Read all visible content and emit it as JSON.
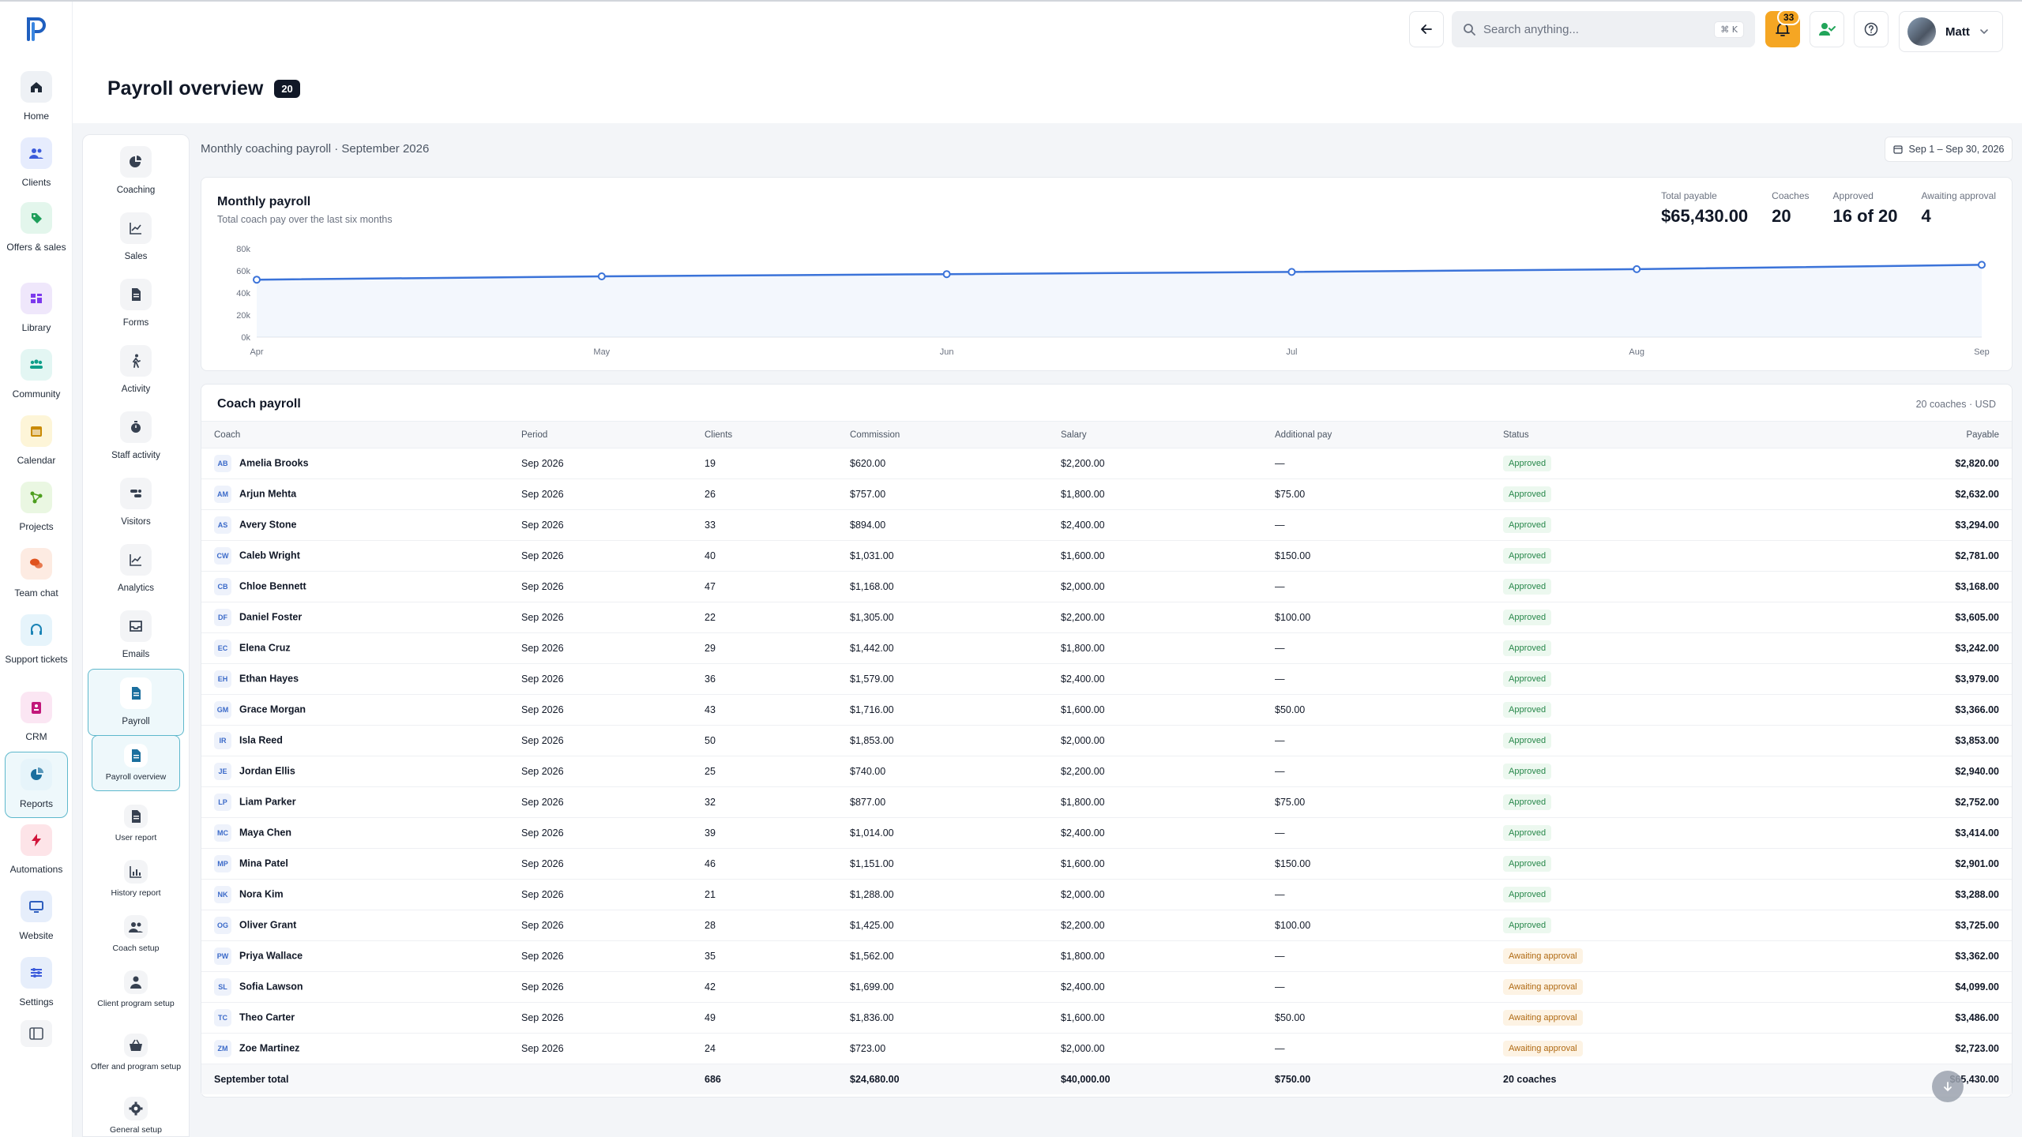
{
  "app": {
    "brand": "P"
  },
  "rail": {
    "items": [
      {
        "label": "Home",
        "icon": "home-icon",
        "color": "#eef1f5",
        "fg": "#1f2937"
      },
      {
        "label": "Clients",
        "icon": "users-icon",
        "color": "#e6ecfd",
        "fg": "#3b5bdb"
      },
      {
        "label": "Offers & sales",
        "icon": "tag-icon",
        "color": "#e3f6ec",
        "fg": "#1e9e5a"
      },
      {
        "label": "Library",
        "icon": "library-icon",
        "color": "#efe7fb",
        "fg": "#7c3aed"
      },
      {
        "label": "Community",
        "icon": "community-icon",
        "color": "#e3f6f3",
        "fg": "#0f9f8a"
      },
      {
        "label": "Calendar",
        "icon": "calendar-icon",
        "color": "#fdf5d8",
        "fg": "#c98a04"
      },
      {
        "label": "Projects",
        "icon": "projects-icon",
        "color": "#eaf7e2",
        "fg": "#4d9e1e"
      },
      {
        "label": "Team chat",
        "icon": "chat-icon",
        "color": "#fdebe2",
        "fg": "#e0531e"
      },
      {
        "label": "Support tickets",
        "icon": "headset-icon",
        "color": "#e6f4fb",
        "fg": "#1b84b6"
      },
      {
        "label": "CRM",
        "icon": "crm-icon",
        "color": "#fbe6f3",
        "fg": "#c2187a"
      },
      {
        "label": "Reports",
        "icon": "reports-icon",
        "color": "#e6f4fa",
        "fg": "#1b6f9e",
        "active": true
      },
      {
        "label": "Automations",
        "icon": "bolt-icon",
        "color": "#fde4e8",
        "fg": "#d1143a"
      },
      {
        "label": "Website",
        "icon": "monitor-icon",
        "color": "#e6eefb",
        "fg": "#2f5fbf"
      },
      {
        "label": "Settings",
        "icon": "sliders-icon",
        "color": "#e6eefb",
        "fg": "#3b5bdb"
      }
    ]
  },
  "header": {
    "title": "Payroll overview",
    "count": "20",
    "search_placeholder": "Search anything...",
    "search_shortcut": "⌘ K",
    "notifications": "33",
    "user_name": "Matt"
  },
  "subnav": {
    "items": [
      {
        "label": "Coaching",
        "icon": "pie-icon"
      },
      {
        "label": "Sales",
        "icon": "line-chart-icon"
      },
      {
        "label": "Forms",
        "icon": "document-icon"
      },
      {
        "label": "Activity",
        "icon": "walk-icon"
      },
      {
        "label": "Staff activity",
        "icon": "stopwatch-icon"
      },
      {
        "label": "Visitors",
        "icon": "visitors-icon"
      },
      {
        "label": "Analytics",
        "icon": "line-chart-icon"
      },
      {
        "label": "Emails",
        "icon": "inbox-icon"
      },
      {
        "label": "Payroll",
        "icon": "document-icon",
        "active": true
      },
      {
        "label": "Payroll overview",
        "icon": "document-icon",
        "active": true
      },
      {
        "label": "User report",
        "icon": "document-icon"
      },
      {
        "label": "History report",
        "icon": "bar-chart-icon"
      },
      {
        "label": "Coach setup",
        "icon": "users-icon"
      },
      {
        "label": "Client program setup",
        "icon": "user-icon"
      },
      {
        "label": "Offer and program setup",
        "icon": "basket-icon"
      },
      {
        "label": "General setup",
        "icon": "gear-icon"
      }
    ]
  },
  "main": {
    "breadcrumb": "Monthly coaching payroll · September 2026",
    "date_range": "Sep 1 – Sep 30, 2026"
  },
  "summary": {
    "title": "Monthly payroll",
    "subtitle": "Total coach pay over the last six months",
    "kpis": [
      {
        "label": "Total payable",
        "value": "$65,430.00"
      },
      {
        "label": "Coaches",
        "value": "20"
      },
      {
        "label": "Approved",
        "value": "16 of 20"
      },
      {
        "label": "Awaiting approval",
        "value": "4"
      }
    ]
  },
  "chart_data": {
    "type": "area",
    "title": "Monthly payroll",
    "categories": [
      "Apr",
      "May",
      "Jun",
      "Jul",
      "Aug",
      "Sep"
    ],
    "series": [
      {
        "values": [
          52000,
          55000,
          57000,
          59000,
          61500,
          65430
        ]
      }
    ],
    "y_ticks": [
      "0k",
      "20k",
      "40k",
      "60k",
      "80k"
    ],
    "ylim": [
      0,
      80000
    ],
    "grid": false,
    "color": "#3b73d9"
  },
  "table": {
    "title": "Coach payroll",
    "meta": "20 coaches · USD",
    "columns": [
      "Coach",
      "Period",
      "Clients",
      "Commission",
      "Salary",
      "Additional pay",
      "Status",
      "Payable"
    ],
    "rows": [
      {
        "initials": "AB",
        "name": "Amelia Brooks",
        "period": "Sep 2026",
        "clients": "19",
        "commission": "$620.00",
        "salary": "$2,200.00",
        "additional": "—",
        "status": "Approved",
        "payable": "$2,820.00"
      },
      {
        "initials": "AM",
        "name": "Arjun Mehta",
        "period": "Sep 2026",
        "clients": "26",
        "commission": "$757.00",
        "salary": "$1,800.00",
        "additional": "$75.00",
        "status": "Approved",
        "payable": "$2,632.00"
      },
      {
        "initials": "AS",
        "name": "Avery Stone",
        "period": "Sep 2026",
        "clients": "33",
        "commission": "$894.00",
        "salary": "$2,400.00",
        "additional": "—",
        "status": "Approved",
        "payable": "$3,294.00"
      },
      {
        "initials": "CW",
        "name": "Caleb Wright",
        "period": "Sep 2026",
        "clients": "40",
        "commission": "$1,031.00",
        "salary": "$1,600.00",
        "additional": "$150.00",
        "status": "Approved",
        "payable": "$2,781.00"
      },
      {
        "initials": "CB",
        "name": "Chloe Bennett",
        "period": "Sep 2026",
        "clients": "47",
        "commission": "$1,168.00",
        "salary": "$2,000.00",
        "additional": "—",
        "status": "Approved",
        "payable": "$3,168.00"
      },
      {
        "initials": "DF",
        "name": "Daniel Foster",
        "period": "Sep 2026",
        "clients": "22",
        "commission": "$1,305.00",
        "salary": "$2,200.00",
        "additional": "$100.00",
        "status": "Approved",
        "payable": "$3,605.00"
      },
      {
        "initials": "EC",
        "name": "Elena Cruz",
        "period": "Sep 2026",
        "clients": "29",
        "commission": "$1,442.00",
        "salary": "$1,800.00",
        "additional": "—",
        "status": "Approved",
        "payable": "$3,242.00"
      },
      {
        "initials": "EH",
        "name": "Ethan Hayes",
        "period": "Sep 2026",
        "clients": "36",
        "commission": "$1,579.00",
        "salary": "$2,400.00",
        "additional": "—",
        "status": "Approved",
        "payable": "$3,979.00"
      },
      {
        "initials": "GM",
        "name": "Grace Morgan",
        "period": "Sep 2026",
        "clients": "43",
        "commission": "$1,716.00",
        "salary": "$1,600.00",
        "additional": "$50.00",
        "status": "Approved",
        "payable": "$3,366.00"
      },
      {
        "initials": "IR",
        "name": "Isla Reed",
        "period": "Sep 2026",
        "clients": "50",
        "commission": "$1,853.00",
        "salary": "$2,000.00",
        "additional": "—",
        "status": "Approved",
        "payable": "$3,853.00"
      },
      {
        "initials": "JE",
        "name": "Jordan Ellis",
        "period": "Sep 2026",
        "clients": "25",
        "commission": "$740.00",
        "salary": "$2,200.00",
        "additional": "—",
        "status": "Approved",
        "payable": "$2,940.00"
      },
      {
        "initials": "LP",
        "name": "Liam Parker",
        "period": "Sep 2026",
        "clients": "32",
        "commission": "$877.00",
        "salary": "$1,800.00",
        "additional": "$75.00",
        "status": "Approved",
        "payable": "$2,752.00"
      },
      {
        "initials": "MC",
        "name": "Maya Chen",
        "period": "Sep 2026",
        "clients": "39",
        "commission": "$1,014.00",
        "salary": "$2,400.00",
        "additional": "—",
        "status": "Approved",
        "payable": "$3,414.00"
      },
      {
        "initials": "MP",
        "name": "Mina Patel",
        "period": "Sep 2026",
        "clients": "46",
        "commission": "$1,151.00",
        "salary": "$1,600.00",
        "additional": "$150.00",
        "status": "Approved",
        "payable": "$2,901.00"
      },
      {
        "initials": "NK",
        "name": "Nora Kim",
        "period": "Sep 2026",
        "clients": "21",
        "commission": "$1,288.00",
        "salary": "$2,000.00",
        "additional": "—",
        "status": "Approved",
        "payable": "$3,288.00"
      },
      {
        "initials": "OG",
        "name": "Oliver Grant",
        "period": "Sep 2026",
        "clients": "28",
        "commission": "$1,425.00",
        "salary": "$2,200.00",
        "additional": "$100.00",
        "status": "Approved",
        "payable": "$3,725.00"
      },
      {
        "initials": "PW",
        "name": "Priya Wallace",
        "period": "Sep 2026",
        "clients": "35",
        "commission": "$1,562.00",
        "salary": "$1,800.00",
        "additional": "—",
        "status": "Awaiting approval",
        "payable": "$3,362.00"
      },
      {
        "initials": "SL",
        "name": "Sofia Lawson",
        "period": "Sep 2026",
        "clients": "42",
        "commission": "$1,699.00",
        "salary": "$2,400.00",
        "additional": "—",
        "status": "Awaiting approval",
        "payable": "$4,099.00"
      },
      {
        "initials": "TC",
        "name": "Theo Carter",
        "period": "Sep 2026",
        "clients": "49",
        "commission": "$1,836.00",
        "salary": "$1,600.00",
        "additional": "$50.00",
        "status": "Awaiting approval",
        "payable": "$3,486.00"
      },
      {
        "initials": "ZM",
        "name": "Zoe Martinez",
        "period": "Sep 2026",
        "clients": "24",
        "commission": "$723.00",
        "salary": "$2,000.00",
        "additional": "—",
        "status": "Awaiting approval",
        "payable": "$2,723.00"
      }
    ],
    "footer": {
      "label": "September total",
      "clients": "686",
      "commission": "$24,680.00",
      "salary": "$40,000.00",
      "additional": "$750.00",
      "status": "20 coaches",
      "payable": "$65,430.00"
    }
  }
}
